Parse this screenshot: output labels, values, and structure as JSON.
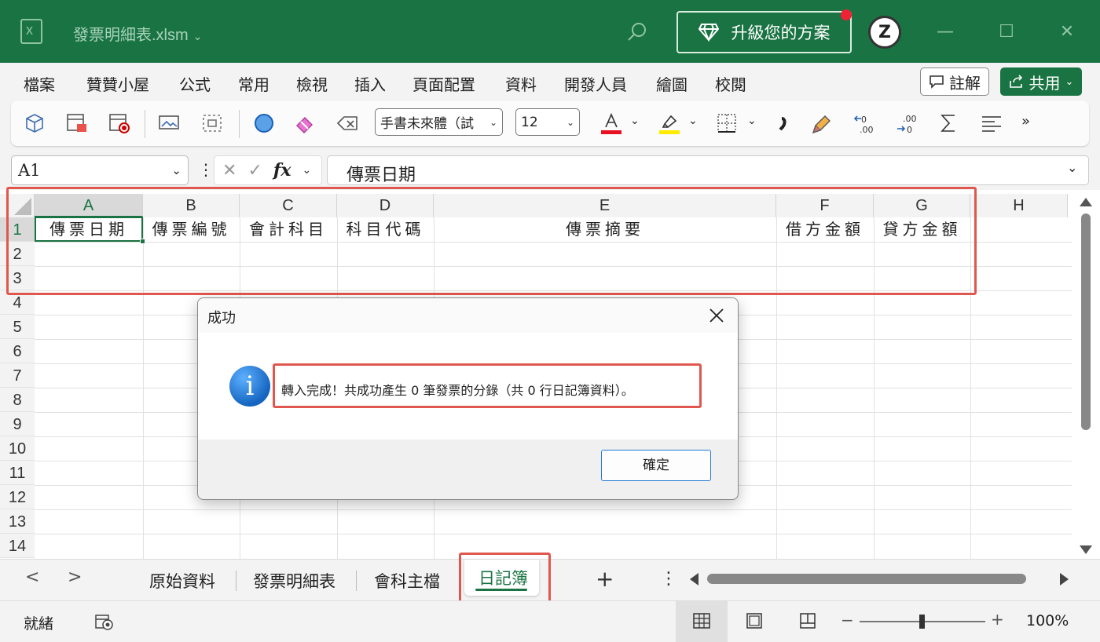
{
  "titlebar": {
    "filename": "發票明細表.xlsm",
    "upgrade_label": "升級您的方案",
    "avatar_text": "Z",
    "accent_color": "#1a7343"
  },
  "menu": {
    "items": [
      "檔案",
      "贊贊小屋",
      "公式",
      "常用",
      "檢視",
      "插入",
      "頁面配置",
      "資料",
      "開發人員",
      "繪圖",
      "校閱"
    ],
    "comment_label": "註解",
    "share_label": "共用"
  },
  "ribbon": {
    "font_name": "手書未來體（試",
    "font_size": "12",
    "font_color": "#e81123",
    "highlight_color": "#ffeb00"
  },
  "formula_bar": {
    "name_box": "A1",
    "fx_label": "fx",
    "value": "傳票日期"
  },
  "sheet": {
    "columns": [
      "A",
      "B",
      "C",
      "D",
      "E",
      "F",
      "G",
      "H"
    ],
    "rows": [
      "1",
      "2",
      "3",
      "4",
      "5",
      "6",
      "7",
      "8",
      "9",
      "10",
      "11",
      "12",
      "13",
      "14"
    ],
    "header_cells": [
      "傳票日期",
      "傳票編號",
      "會計科目",
      "科目代碼",
      "傳票摘要",
      "借方金額",
      "貸方金額"
    ]
  },
  "dialog": {
    "title": "成功",
    "message": "轉入完成！共成功產生 0 筆發票的分錄（共 0 行日記簿資料）。",
    "ok_label": "確定"
  },
  "tabs": {
    "items": [
      "原始資料",
      "發票明細表",
      "會科主檔"
    ],
    "active": "日記簿",
    "add_label": "+",
    "more_label": "⋮"
  },
  "status": {
    "ready": "就緒",
    "zoom": "100%"
  }
}
